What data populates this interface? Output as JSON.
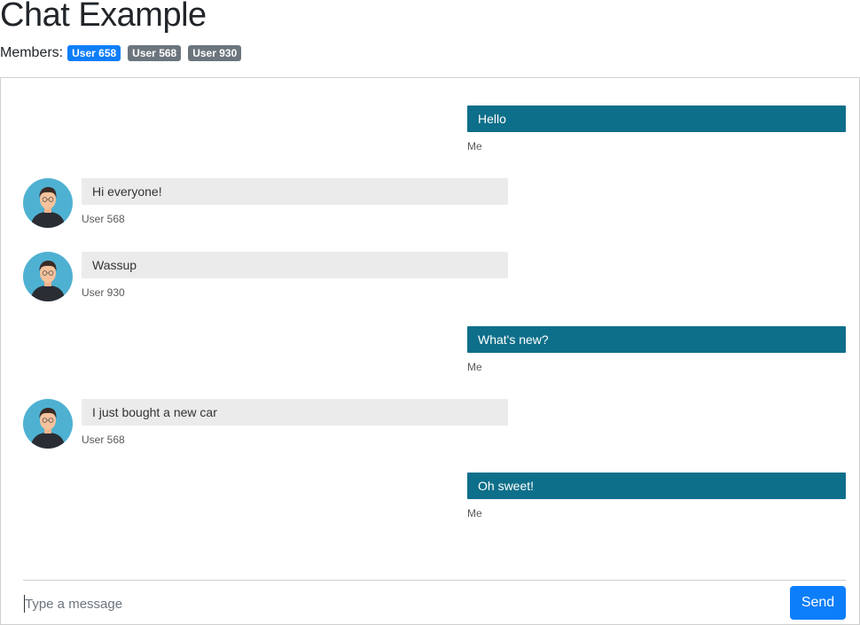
{
  "header": {
    "title": "Chat Example",
    "members_label": "Members:",
    "members": [
      {
        "name": "User 658",
        "color": "#0d7ef9"
      },
      {
        "name": "User 568",
        "color": "#6c757d"
      },
      {
        "name": "User 930",
        "color": "#6c757d"
      }
    ]
  },
  "messages": [
    {
      "text": "Hello",
      "sender": "Me",
      "direction": "sent"
    },
    {
      "text": "Hi everyone!",
      "sender": "User 568",
      "direction": "received",
      "avatar_icon": "user-avatar-icon"
    },
    {
      "text": "Wassup",
      "sender": "User 930",
      "direction": "received",
      "avatar_icon": "user-avatar-icon"
    },
    {
      "text": "What's new?",
      "sender": "Me",
      "direction": "sent"
    },
    {
      "text": "I just bought a new car",
      "sender": "User 568",
      "direction": "received",
      "avatar_icon": "user-avatar-icon"
    },
    {
      "text": "Oh sweet!",
      "sender": "Me",
      "direction": "sent"
    }
  ],
  "composer": {
    "placeholder": "Type a message",
    "value": "",
    "send_label": "Send"
  },
  "colors": {
    "sent_bubble": "#0e6f8a",
    "received_bubble": "#ebebeb",
    "accent": "#0d7ef9",
    "badge_secondary": "#6c757d",
    "avatar_bg": "#4fb1d2"
  }
}
